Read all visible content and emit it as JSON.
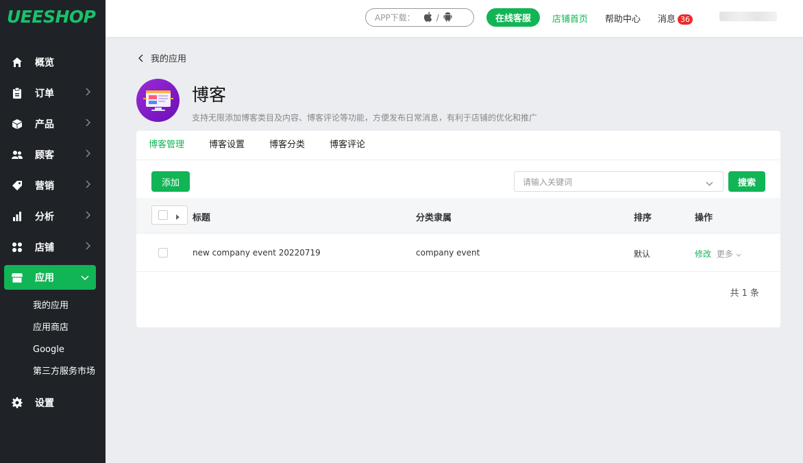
{
  "brand": {
    "logo_text": "UEESHOP"
  },
  "sidebar": {
    "items": [
      {
        "label": "概览",
        "icon": "home-icon"
      },
      {
        "label": "订单",
        "icon": "clipboard-icon"
      },
      {
        "label": "产品",
        "icon": "box-icon"
      },
      {
        "label": "顾客",
        "icon": "users-icon"
      },
      {
        "label": "营销",
        "icon": "tag-icon"
      },
      {
        "label": "分析",
        "icon": "bar-chart-icon"
      },
      {
        "label": "店铺",
        "icon": "grid-icon"
      },
      {
        "label": "应用",
        "icon": "store-icon"
      },
      {
        "label": "设置",
        "icon": "gear-icon"
      }
    ],
    "sub_items": [
      "我的应用",
      "应用商店",
      "Google",
      "第三方服务市场"
    ]
  },
  "header": {
    "app_download": "APP下载：",
    "separator": "/",
    "online_service": "在线客服",
    "store_home": "店铺首页",
    "help_center": "帮助中心",
    "messages": "消息",
    "message_count": "36"
  },
  "page": {
    "back_label": "我的应用",
    "title": "博客",
    "description": "支持无限添加博客类目及内容、博客评论等功能，方便发布日常消息，有利于店铺的优化和推广"
  },
  "tabs": [
    "博客管理",
    "博客设置",
    "博客分类",
    "博客评论"
  ],
  "toolbar": {
    "add_label": "添加",
    "search_placeholder": "请输入关键词",
    "search_label": "搜索"
  },
  "table": {
    "headers": [
      "标题",
      "分类隶属",
      "排序",
      "操作"
    ],
    "rows": [
      {
        "title": "new company event 20220719",
        "category": "company event",
        "order": "默认",
        "edit": "修改",
        "more": "更多"
      }
    ],
    "total": "共 1 条"
  },
  "colors": {
    "accent": "#11b556",
    "sidebar_bg": "#1f2328",
    "badge": "#ec2a2a"
  }
}
